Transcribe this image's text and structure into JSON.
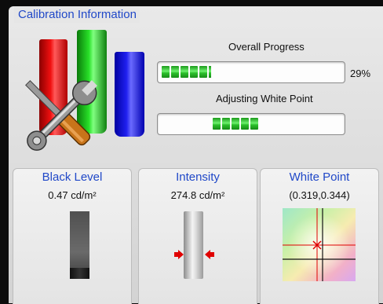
{
  "panel": {
    "title": "Calibration Information"
  },
  "overall": {
    "label": "Overall Progress",
    "percent_text": "29%",
    "fraction": 0.29
  },
  "adjusting": {
    "label": "Adjusting White Point",
    "segments_lit": 5
  },
  "cards": {
    "black": {
      "title": "Black Level",
      "value": "0.47 cd/m²"
    },
    "intensity": {
      "title": "Intensity",
      "value": "274.8 cd/m²"
    },
    "white": {
      "title": "White Point",
      "value": "(0.319,0.344)"
    }
  },
  "colors": {
    "title_blue": "#2048c8",
    "progress_green": "#2cc02c",
    "indicator_red": "#e00000",
    "tube_red": "#e01010",
    "tube_green": "#20d020",
    "tube_blue": "#1010e0"
  },
  "icons": {
    "banner": "rgb-tubes-icon",
    "tools": "wrench-screwdriver-icon",
    "arrows": "red-arrow-icon",
    "crosshair": "crosshair-icon"
  }
}
